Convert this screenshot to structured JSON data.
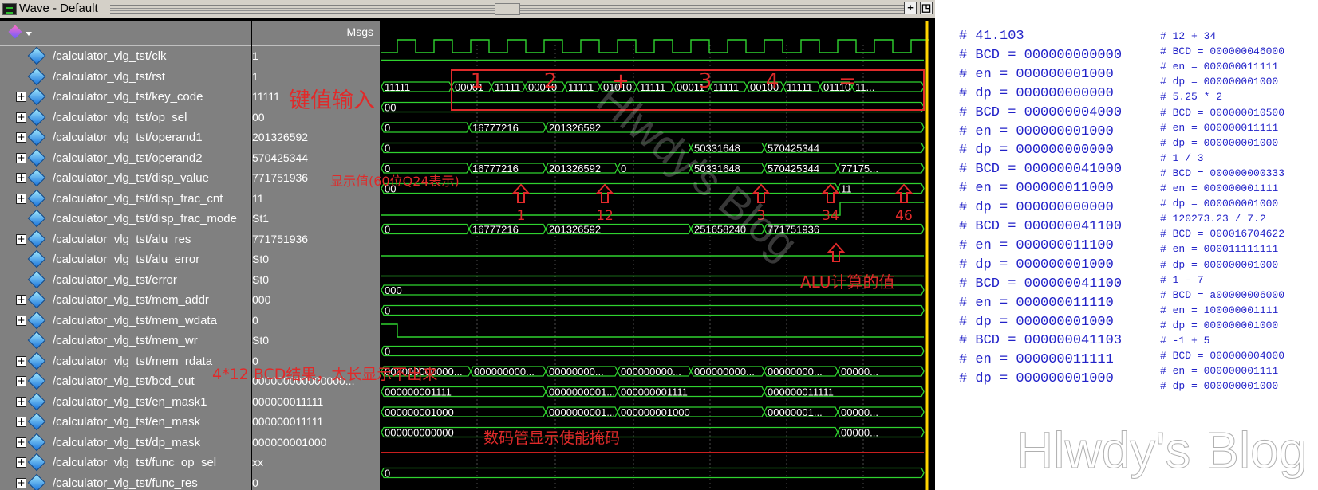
{
  "window": {
    "title": "Wave - Default"
  },
  "header": {
    "msgs_label": "Msgs"
  },
  "signals": [
    {
      "name": "/calculator_vlg_tst/clk",
      "value": "1",
      "expandable": false
    },
    {
      "name": "/calculator_vlg_tst/rst",
      "value": "1",
      "expandable": false
    },
    {
      "name": "/calculator_vlg_tst/key_code",
      "value": "11111",
      "expandable": true
    },
    {
      "name": "/calculator_vlg_tst/op_sel",
      "value": "00",
      "expandable": true
    },
    {
      "name": "/calculator_vlg_tst/operand1",
      "value": "201326592",
      "expandable": true
    },
    {
      "name": "/calculator_vlg_tst/operand2",
      "value": "570425344",
      "expandable": true
    },
    {
      "name": "/calculator_vlg_tst/disp_value",
      "value": "771751936",
      "expandable": true
    },
    {
      "name": "/calculator_vlg_tst/disp_frac_cnt",
      "value": "11",
      "expandable": true
    },
    {
      "name": "/calculator_vlg_tst/disp_frac_mode",
      "value": "St1",
      "expandable": false
    },
    {
      "name": "/calculator_vlg_tst/alu_res",
      "value": "771751936",
      "expandable": true
    },
    {
      "name": "/calculator_vlg_tst/alu_error",
      "value": "St0",
      "expandable": false
    },
    {
      "name": "/calculator_vlg_tst/error",
      "value": "St0",
      "expandable": false
    },
    {
      "name": "/calculator_vlg_tst/mem_addr",
      "value": "000",
      "expandable": true
    },
    {
      "name": "/calculator_vlg_tst/mem_wdata",
      "value": "0",
      "expandable": true
    },
    {
      "name": "/calculator_vlg_tst/mem_wr",
      "value": "St0",
      "expandable": false
    },
    {
      "name": "/calculator_vlg_tst/mem_rdata",
      "value": "0",
      "expandable": true
    },
    {
      "name": "/calculator_vlg_tst/bcd_out",
      "value": "000000000000000...",
      "expandable": true
    },
    {
      "name": "/calculator_vlg_tst/en_mask1",
      "value": "000000011111",
      "expandable": true
    },
    {
      "name": "/calculator_vlg_tst/en_mask",
      "value": "000000011111",
      "expandable": true
    },
    {
      "name": "/calculator_vlg_tst/dp_mask",
      "value": "000000001000",
      "expandable": true
    },
    {
      "name": "/calculator_vlg_tst/func_op_sel",
      "value": "xx",
      "expandable": true
    },
    {
      "name": "/calculator_vlg_tst/func_res",
      "value": "0",
      "expandable": true
    }
  ],
  "bus_labels": {
    "key_code": [
      "11111",
      "00001",
      "11111",
      "00010",
      "11111",
      "01010",
      "11111",
      "00011",
      "11111",
      "00100",
      "11111",
      "01110",
      "11..."
    ],
    "op_sel": [
      "00"
    ],
    "operand1": [
      "0",
      "16777216",
      "201326592"
    ],
    "operand2": [
      "0",
      "50331648",
      "570425344"
    ],
    "disp_value": [
      "0",
      "16777216",
      "201326592",
      "0",
      "50331648",
      "570425344",
      "77175..."
    ],
    "disp_frac_cnt": [
      "00",
      "11"
    ],
    "alu_res": [
      "0",
      "16777216",
      "201326592",
      "251658240",
      "771751936"
    ],
    "mem_addr": [
      "000"
    ],
    "mem_wdata": [
      "0"
    ],
    "mem_rdata": [
      "0"
    ],
    "bcd_out": [
      "000000000000...",
      "000000000...",
      "00000000...",
      "000000000...",
      "000000000...",
      "00000000...",
      "00000..."
    ],
    "en_mask1": [
      "000000001111",
      "0000000001...",
      "000000001111",
      "000000011111"
    ],
    "en_mask": [
      "000000001000",
      "0000000001...",
      "000000001000",
      "00000001...",
      "00000..."
    ],
    "dp_mask": [
      "000000000000",
      "00000..."
    ],
    "func_res": [
      "0"
    ]
  },
  "annotations": {
    "key_input": "键值输入",
    "keys": [
      "1",
      "2",
      "+",
      "3",
      "4",
      "="
    ],
    "display_value_note": "显示值(60位Q24表示)",
    "arrow_labels": [
      "1",
      "12",
      "3",
      "34",
      "46"
    ],
    "alu_note": "ALU计算的值",
    "bcd_note": "4*12 BCD结果，太长显示不出来",
    "mask_note": "数码管显示使能掩码"
  },
  "console": {
    "col1": [
      "# 41.103",
      "# BCD = 000000000000",
      "# en = 000000001000",
      "# dp = 000000000000",
      "# BCD = 000000004000",
      "# en = 000000001000",
      "# dp = 000000000000",
      "# BCD = 000000041000",
      "# en = 000000011000",
      "# dp = 000000000000",
      "# BCD = 000000041100",
      "# en = 000000011100",
      "# dp = 000000001000",
      "# BCD = 000000041100",
      "# en = 000000011110",
      "# dp = 000000001000",
      "# BCD = 000000041103",
      "# en = 000000011111",
      "# dp = 000000001000"
    ],
    "col2": [
      "# 12 + 34",
      "# BCD = 000000046000",
      "# en = 000000011111",
      "# dp = 000000001000",
      "# 5.25 * 2",
      "# BCD = 000000010500",
      "# en = 000000011111",
      "# dp = 000000001000",
      "# 1 / 3",
      "# BCD = 000000000333",
      "# en = 000000001111",
      "# dp = 000000001000",
      "# 120273.23 / 7.2",
      "# BCD = 000016704622",
      "# en = 000011111111",
      "# dp = 000000001000",
      "# 1 - 7",
      "# BCD = a00000006000",
      "# en = 100000001111",
      "# dp = 000000001000",
      "# -1 + 5",
      "# BCD = 000000004000",
      "# en = 000000001111",
      "# dp = 000000001000"
    ]
  },
  "watermark": "Hlwdy's Blog",
  "colors": {
    "wave": "#2fd22f",
    "cursor": "#ffd400",
    "console_text": "#2222c8",
    "annotation": "#e02a2a",
    "error_trace": "#c81e1e"
  }
}
